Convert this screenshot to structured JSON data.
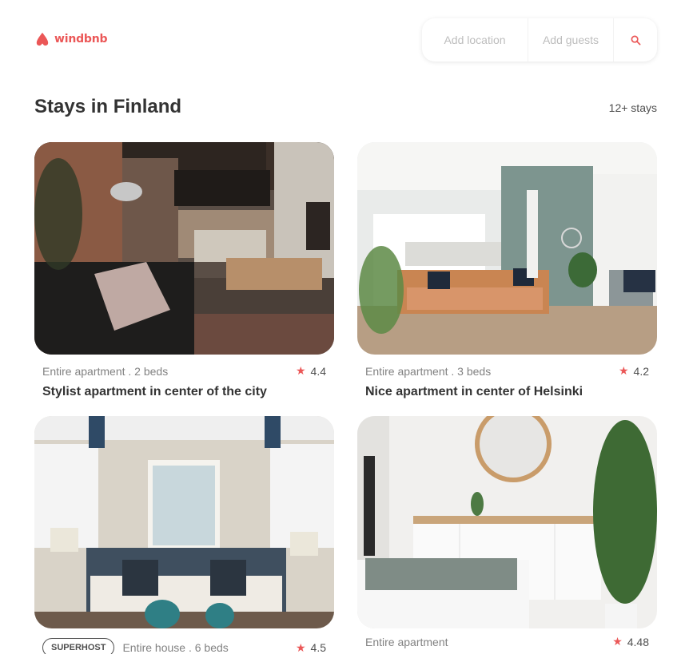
{
  "brand": {
    "name": "windbnb",
    "color": "#EB5757"
  },
  "search": {
    "location_placeholder": "Add location",
    "guests_placeholder": "Add guests",
    "icon": "search-icon"
  },
  "main": {
    "title": "Stays in Finland",
    "count": "12+ stays"
  },
  "stays": [
    {
      "type": "Entire apartment . 2 beds",
      "rating": "4.4",
      "title": "Stylist apartment in center of the city",
      "superhost": ""
    },
    {
      "type": "Entire apartment . 3 beds",
      "rating": "4.2",
      "title": "Nice apartment in center of Helsinki",
      "superhost": ""
    },
    {
      "type": "Entire house . 6 beds",
      "rating": "4.5",
      "title": "",
      "superhost": "SUPERHOST"
    },
    {
      "type": "Entire apartment",
      "rating": "4.48",
      "title": "",
      "superhost": ""
    }
  ]
}
